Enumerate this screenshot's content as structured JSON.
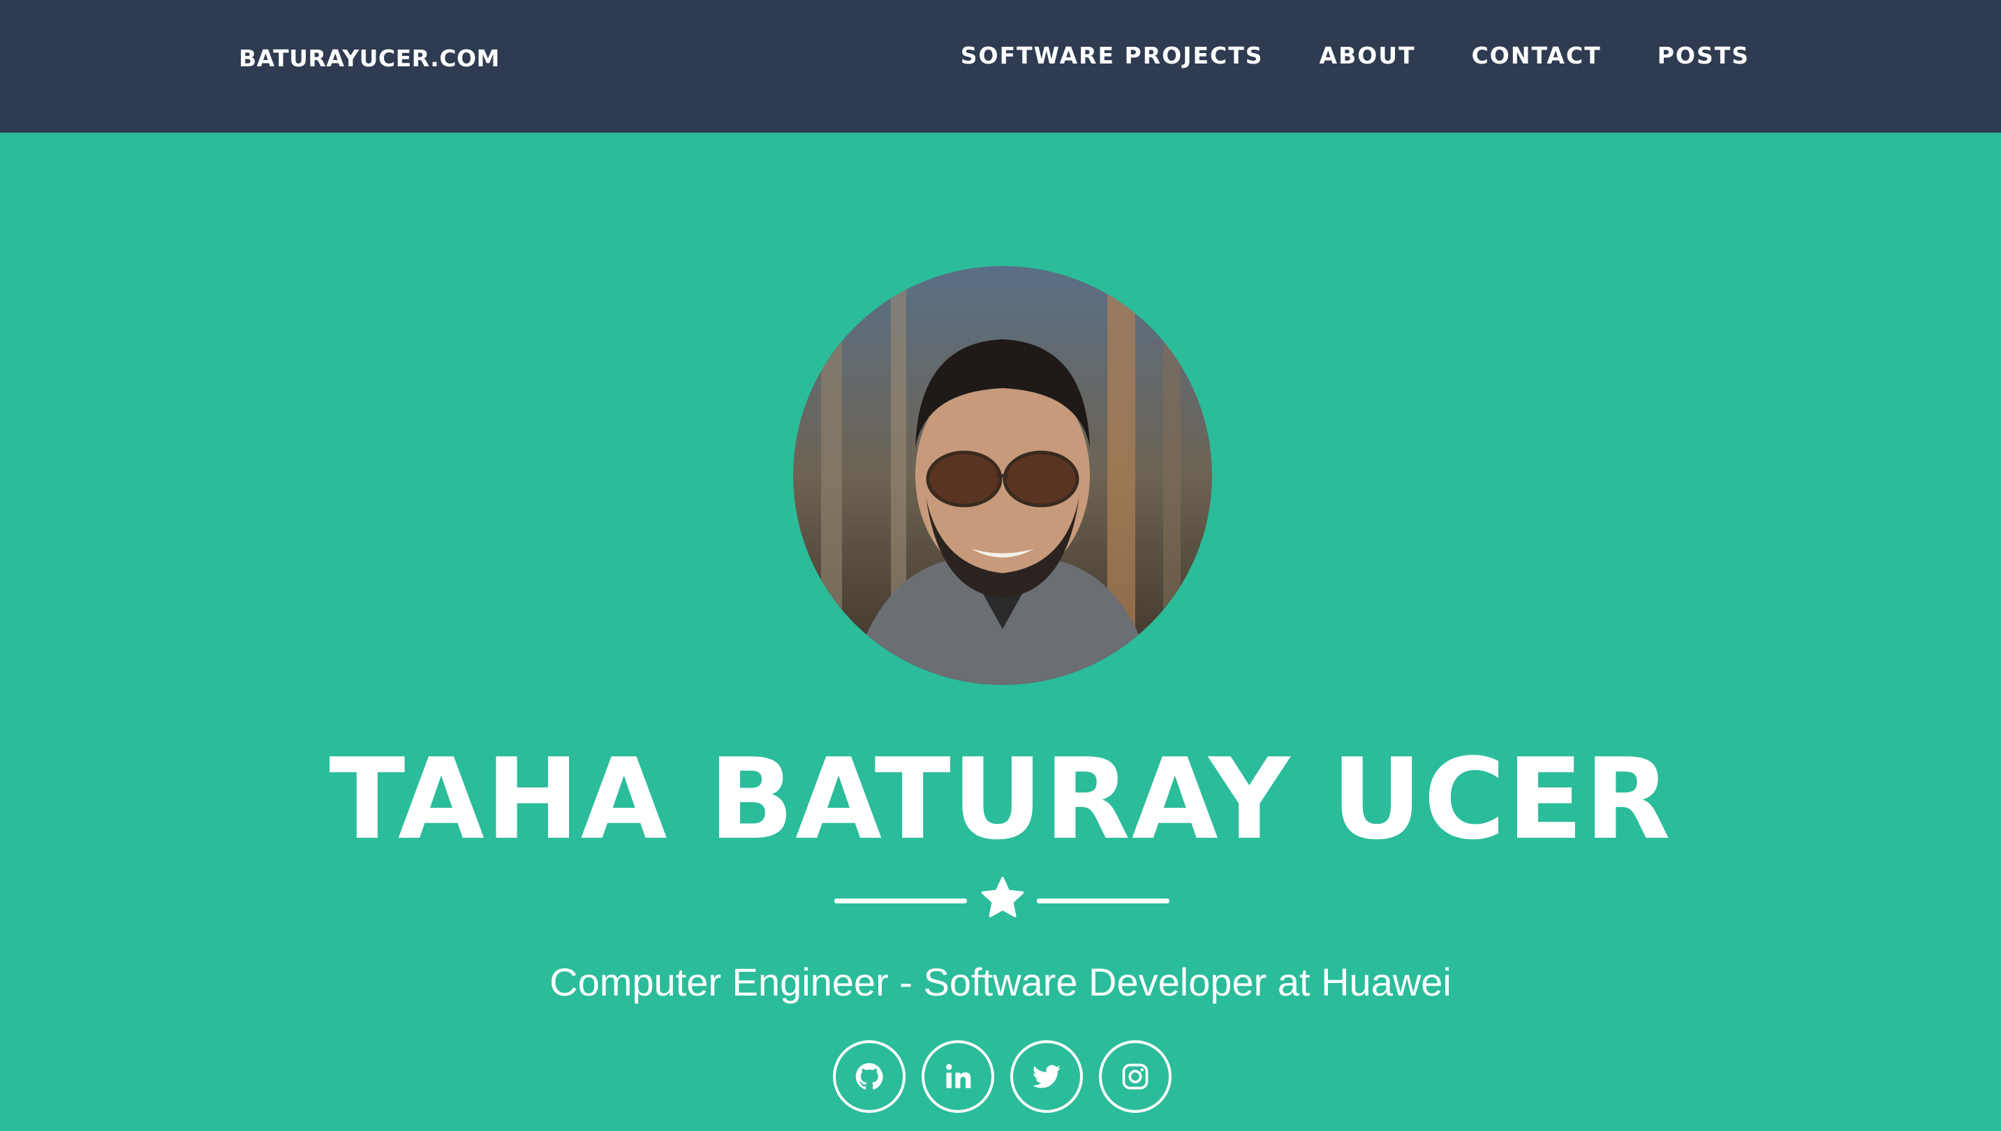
{
  "navbar": {
    "brand": "BATURAYUCER.COM",
    "items": [
      {
        "label": "SOFTWARE PROJECTS"
      },
      {
        "label": "ABOUT"
      },
      {
        "label": "CONTACT"
      },
      {
        "label": "POSTS"
      }
    ]
  },
  "hero": {
    "name": "TAHA BATURAY UCER",
    "subtitle": "Computer Engineer - Software Developer at Huawei",
    "divider_icon": "star-icon",
    "avatar": "profile-photo",
    "socials": [
      {
        "icon": "github-icon"
      },
      {
        "icon": "linkedin-icon"
      },
      {
        "icon": "twitter-icon"
      },
      {
        "icon": "instagram-icon"
      }
    ]
  },
  "colors": {
    "navbar_bg": "#2e3b51",
    "hero_bg": "#2bbc9a",
    "text": "#ffffff"
  }
}
